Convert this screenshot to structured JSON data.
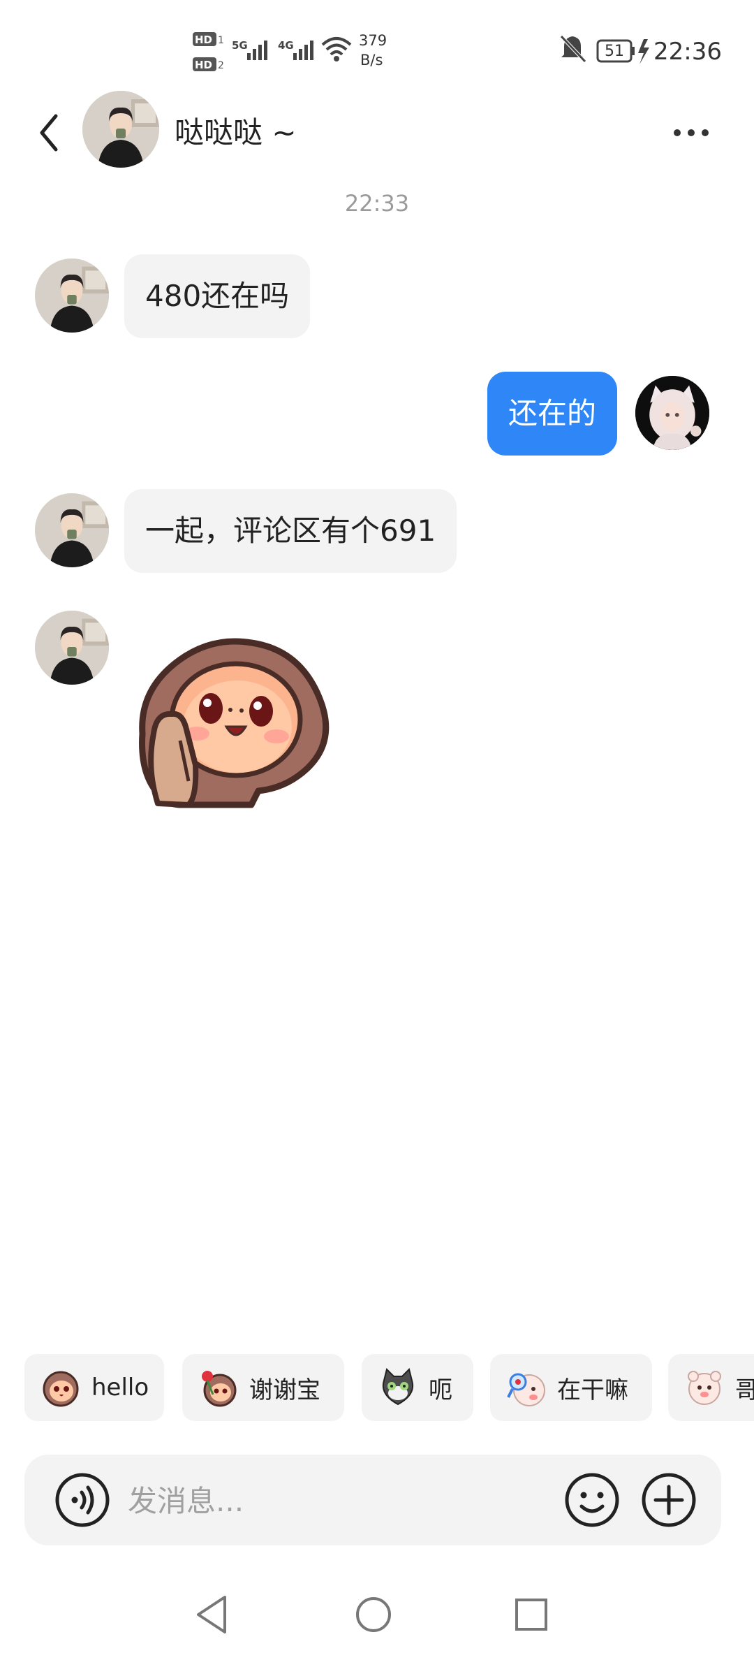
{
  "status_bar": {
    "sim1": "HD1",
    "sim2": "HD2",
    "net1": "5G",
    "net2": "4G",
    "speed_value": "379",
    "speed_unit": "B/s",
    "battery": "51",
    "time": "22:36"
  },
  "header": {
    "title": "哒哒哒 ~"
  },
  "timestamp": "22:33",
  "messages": [
    {
      "sender": "contact",
      "text": "480还在吗"
    },
    {
      "sender": "me",
      "text": "还在的"
    },
    {
      "sender": "contact",
      "text": "一起，评论区有个691"
    },
    {
      "sender": "contact",
      "text": "",
      "type": "sticker",
      "sticker": "monkey-waving-sticker"
    }
  ],
  "quick_stickers": [
    {
      "label": "hello",
      "icon": "monkey-icon"
    },
    {
      "label": "谢谢宝",
      "icon": "monkey-rose-icon"
    },
    {
      "label": "呃",
      "icon": "cat-icon"
    },
    {
      "label": "在干嘛",
      "icon": "bear-magnifier-icon"
    },
    {
      "label": "哥",
      "icon": "bear-icon"
    }
  ],
  "input": {
    "placeholder": "发消息..."
  },
  "colors": {
    "accent": "#2f86f6",
    "bubble_in": "#f3f3f3"
  }
}
